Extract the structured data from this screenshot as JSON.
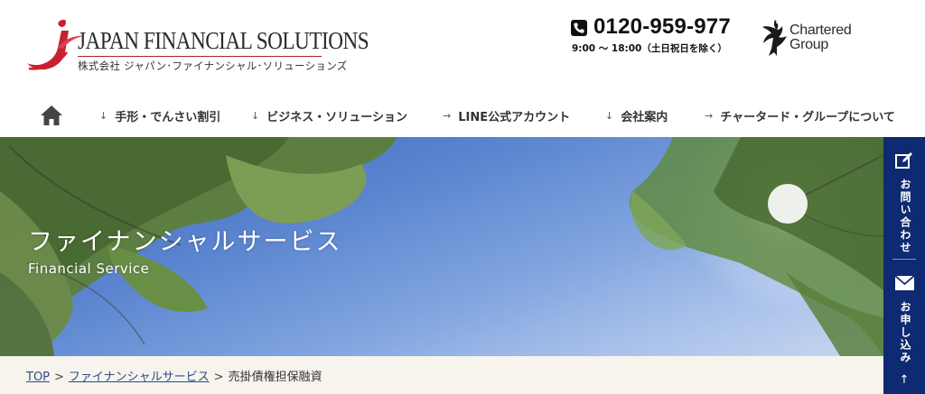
{
  "logo": {
    "name_en": "JAPAN FINANCIAL SOLUTIONS",
    "name_ja": "株式会社 ジャパン･ファイナンシャル･ソリューションズ"
  },
  "contact": {
    "phone": "0120-959-977",
    "hours": "9:00 〜 18:00（土日祝日を除く）"
  },
  "group": {
    "line1": "Chartered",
    "line2": "Group"
  },
  "nav": {
    "items": [
      {
        "label": "手形・でんさい割引",
        "arrow": "↓"
      },
      {
        "label": "ビジネス・ソリューション",
        "arrow": "↓"
      },
      {
        "label": "LINE公式アカウント",
        "arrow": "→"
      },
      {
        "label": "会社案内",
        "arrow": "↓"
      },
      {
        "label": "チャータード・グループについて",
        "arrow": "→"
      }
    ]
  },
  "hero": {
    "title": "ファイナンシャルサービス",
    "subtitle": "Financial Service"
  },
  "sidebar": {
    "contact_label": "お問い合わせ",
    "apply_label": "お申し込み",
    "top_arrow": "↑"
  },
  "breadcrumb": {
    "items": [
      "TOP",
      "ファイナンシャルサービス"
    ],
    "current": "売掛債権担保融資",
    "separator": ">"
  },
  "colors": {
    "brand_red": "#c8202f",
    "navy": "#0e2a72",
    "link": "#2c4a8f"
  }
}
